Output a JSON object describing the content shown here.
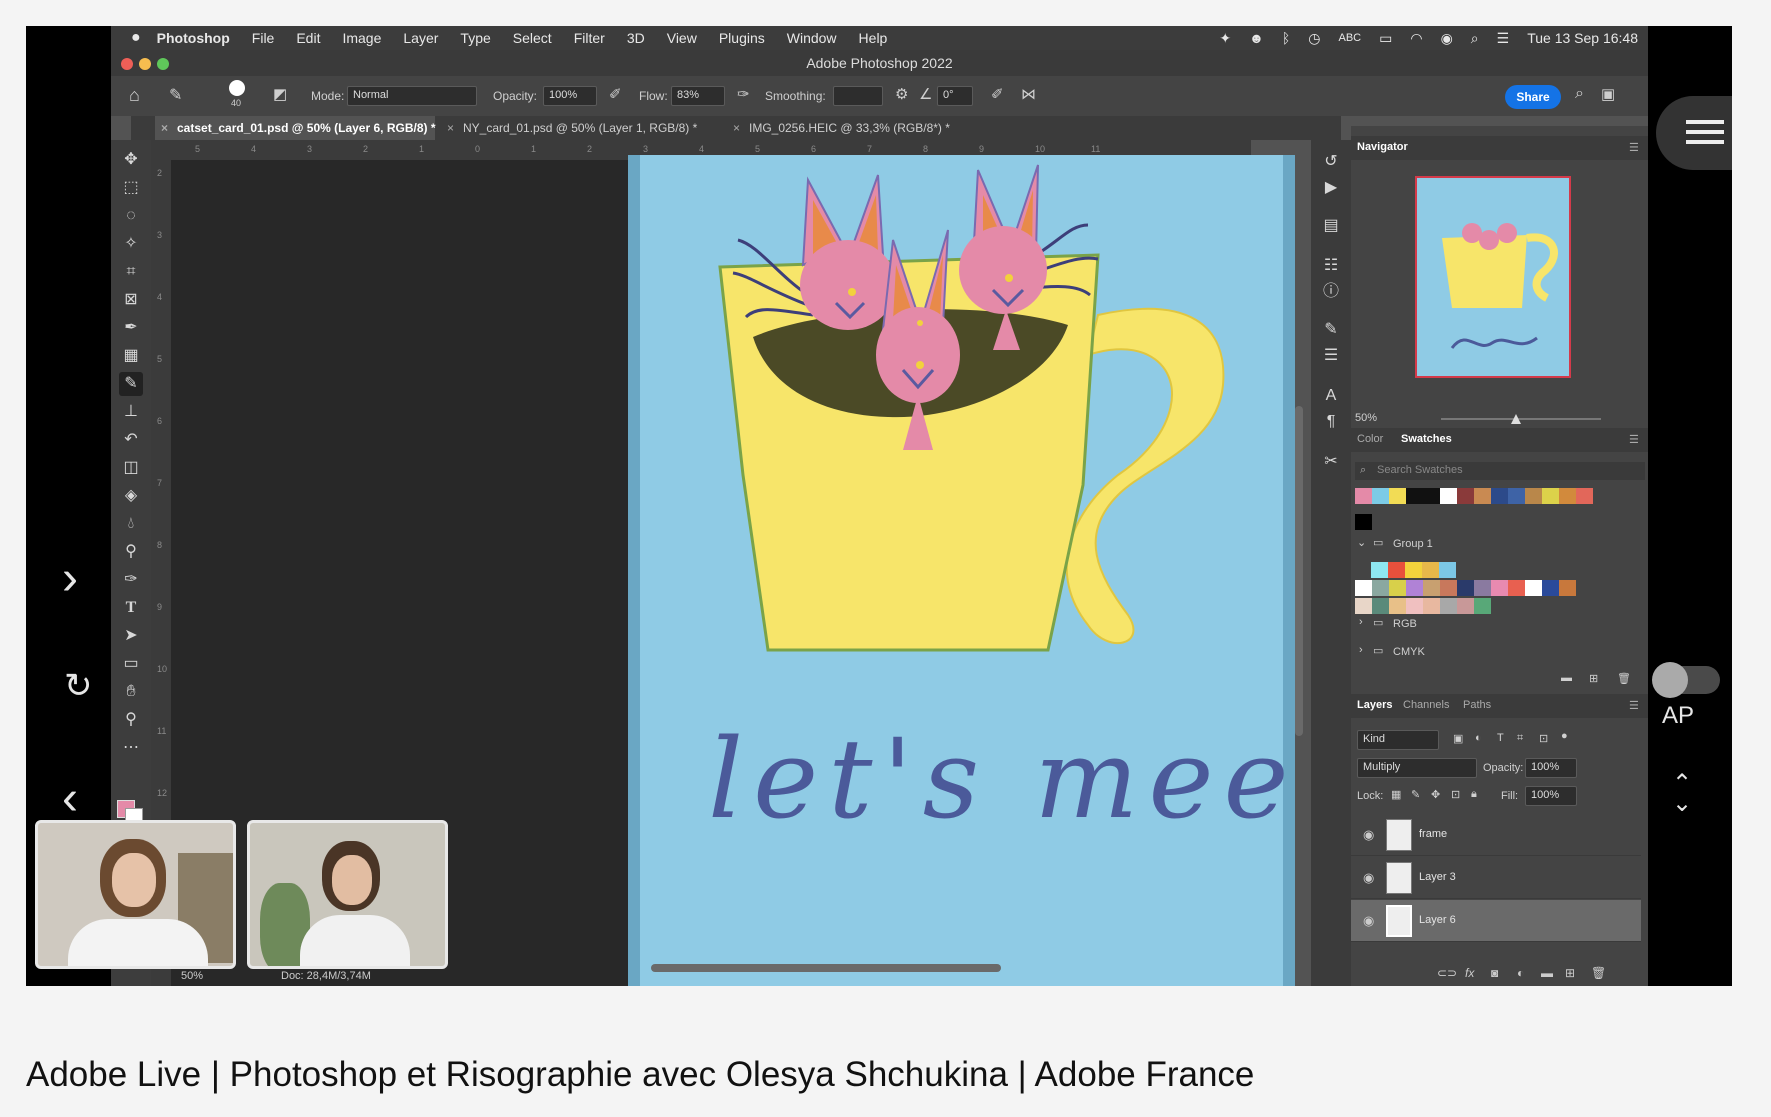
{
  "menubar": {
    "app_name": "Photoshop",
    "items": [
      "File",
      "Edit",
      "Image",
      "Layer",
      "Type",
      "Select",
      "Filter",
      "3D",
      "View",
      "Plugins",
      "Window",
      "Help"
    ],
    "keyboard": "ABC",
    "datetime": "Tue 13 Sep  16:48"
  },
  "window": {
    "title": "Adobe Photoshop 2022"
  },
  "options": {
    "brush_size": "40",
    "mode_label": "Mode:",
    "mode_value": "Normal",
    "opacity_label": "Opacity:",
    "opacity_value": "100%",
    "flow_label": "Flow:",
    "flow_value": "83%",
    "smoothing_label": "Smoothing:",
    "angle_value": "0°",
    "share_label": "Share"
  },
  "tabs": [
    {
      "label": "catset_card_01.psd @ 50% (Layer 6, RGB/8) *",
      "active": true
    },
    {
      "label": "NY_card_01.psd @ 50% (Layer 1, RGB/8) *",
      "active": false
    },
    {
      "label": "IMG_0256.HEIC @ 33,3% (RGB/8*) *",
      "active": false
    }
  ],
  "ruler": {
    "h_ticks": [
      "5",
      "4",
      "3",
      "2",
      "1",
      "0",
      "1",
      "2",
      "3",
      "4",
      "5",
      "6",
      "7",
      "8",
      "9",
      "10",
      "11"
    ],
    "v_ticks": [
      "2",
      "3",
      "4",
      "5",
      "6",
      "7",
      "8",
      "9",
      "10",
      "11",
      "12"
    ]
  },
  "canvas": {
    "lettering": "let's meet!"
  },
  "status": {
    "zoom": "50%",
    "doc": "Doc: 28,4M/3,74M"
  },
  "navigator": {
    "title": "Navigator",
    "zoom": "50%"
  },
  "swatches": {
    "tab_color": "Color",
    "tab_swatches": "Swatches",
    "search_placeholder": "Search Swatches",
    "top_row": [
      "#e48aa8",
      "#7ccbe6",
      "#f2dc55",
      "#111111",
      "#111111",
      "#ffffff",
      "#8a3a3a",
      "#c98a52",
      "#2c4a8a",
      "#3e63a6",
      "#b9874a",
      "#dcd24a",
      "#d28a3c",
      "#e2675a"
    ],
    "group1_label": "Group 1",
    "group1_row1": [
      "#8ee6f0",
      "#e8503c",
      "#f2d23c",
      "#e8b84a",
      "#7cc8e6"
    ],
    "group1_row2": [
      "#ffffff",
      "#8aa8a0",
      "#d8d04a",
      "#b082d6",
      "#c8a070",
      "#c8785c",
      "#2a3a6a",
      "#8a7aa0",
      "#e88ab0",
      "#e86050",
      "#ffffff",
      "#2a4a9a",
      "#c8783c"
    ],
    "group1_row3": [
      "#e8d6c8",
      "#5a8a7a",
      "#e8c088",
      "#f0c0c0",
      "#e8b8a0",
      "#a8a8a8",
      "#c89898",
      "#58a878"
    ],
    "folders": [
      "RGB",
      "CMYK"
    ]
  },
  "layers_panel": {
    "tabs": [
      "Layers",
      "Channels",
      "Paths"
    ],
    "filter": "Kind",
    "blend_mode": "Multiply",
    "opacity_label": "Opacity:",
    "opacity_value": "100%",
    "lock_label": "Lock:",
    "fill_label": "Fill:",
    "fill_value": "100%",
    "layers": [
      {
        "name": "frame",
        "selected": false
      },
      {
        "name": "Layer 3",
        "selected": false
      },
      {
        "name": "Layer 6",
        "selected": true
      }
    ]
  },
  "player_overlay": {
    "autoplay_label": "AP"
  },
  "video_title": "Adobe Live | Photoshop et Risographie avec Olesya Shchukina | Adobe France"
}
